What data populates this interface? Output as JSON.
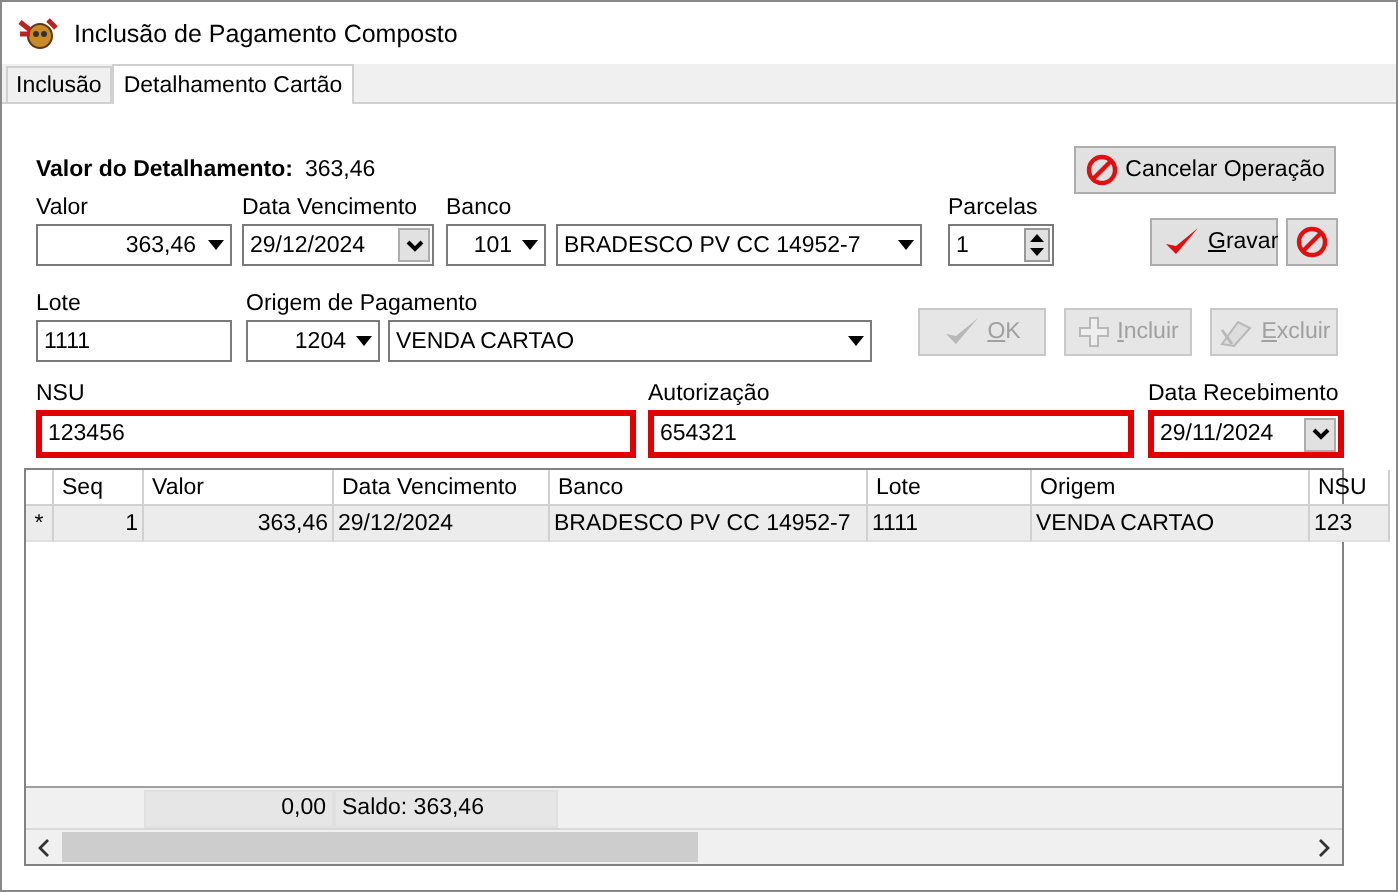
{
  "window": {
    "title": "Inclusão de Pagamento Composto"
  },
  "tabs": [
    {
      "label": "Inclusão",
      "selected": false
    },
    {
      "label": "Detalhamento Cartão",
      "selected": true
    }
  ],
  "summary": {
    "label": "Valor do Detalhamento:",
    "value": "363,46"
  },
  "valor": {
    "label": "Valor",
    "value": "363,46"
  },
  "data_vencimento": {
    "label": "Data Vencimento",
    "value": "29/12/2024"
  },
  "banco": {
    "label": "Banco",
    "code": "101",
    "name": "BRADESCO PV CC 14952-7"
  },
  "parcelas": {
    "label": "Parcelas",
    "value": "1"
  },
  "lote": {
    "label": "Lote",
    "value": "1111"
  },
  "origem": {
    "label": "Origem de Pagamento",
    "code": "1204",
    "name": "VENDA CARTAO"
  },
  "nsu": {
    "label": "NSU",
    "value": "123456",
    "highlighted": true
  },
  "autorizacao": {
    "label": "Autorização",
    "value": "654321",
    "highlighted": true
  },
  "data_recebimento": {
    "label": "Data Recebimento",
    "value": "29/11/2024",
    "highlighted": true
  },
  "buttons": {
    "cancelar": {
      "label": "Cancelar Operação",
      "disabled": false
    },
    "gravar": {
      "label": "Gravar",
      "disabled": false
    },
    "cancel_icon": {
      "disabled": false
    },
    "ok": {
      "label": "OK",
      "disabled": true
    },
    "incluir": {
      "label": "Incluir",
      "disabled": true
    },
    "excluir": {
      "label": "Excluir",
      "disabled": true
    }
  },
  "grid": {
    "columns": [
      {
        "label": "Seq"
      },
      {
        "label": "Valor"
      },
      {
        "label": "Data Vencimento"
      },
      {
        "label": "Banco"
      },
      {
        "label": "Lote"
      },
      {
        "label": "Origem"
      },
      {
        "label": "NSU"
      }
    ],
    "rows": [
      {
        "indicator": "*",
        "selected": true,
        "cells": [
          "1",
          "363,46",
          "29/12/2024",
          "BRADESCO PV CC 14952-7",
          "1111",
          "VENDA CARTAO",
          "123"
        ]
      }
    ],
    "footer": [
      "0,00",
      "Saldo: 363,46"
    ]
  }
}
